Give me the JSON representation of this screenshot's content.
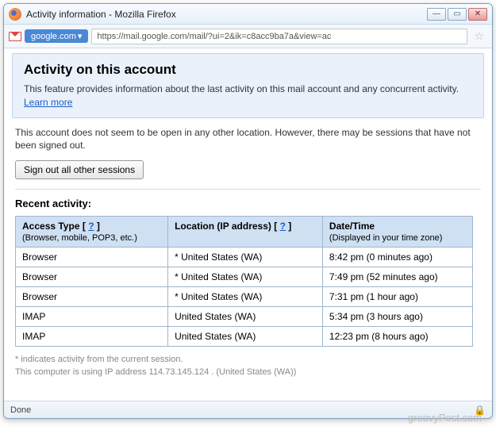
{
  "window": {
    "title": "Activity information - Mozilla Firefox",
    "min": "—",
    "max": "▭",
    "close": "✕"
  },
  "address": {
    "site_label": "google.com",
    "dropdown_glyph": "▾",
    "url": "https://mail.google.com/mail/?ui=2&ik=c8acc9ba7a&view=ac"
  },
  "header": {
    "title": "Activity on this account",
    "description": "This feature provides information about the last activity on this mail account and any concurrent activity.",
    "learn_more": "Learn more"
  },
  "session_info": {
    "message": "This account does not seem to be open in any other location. However, there may be sessions that have not been signed out.",
    "signout_button": "Sign out all other sessions"
  },
  "recent": {
    "title": "Recent activity:",
    "columns": {
      "access": "Access Type",
      "access_sub": "(Browser, mobile, POP3, etc.)",
      "location": "Location (IP address)",
      "datetime": "Date/Time",
      "datetime_sub": "(Displayed in your time zone)",
      "help": "?",
      "bracket_open": "[ ",
      "bracket_close": " ]"
    },
    "rows": [
      {
        "access": "Browser",
        "location": "* United States (WA)",
        "datetime": "8:42 pm (0 minutes ago)"
      },
      {
        "access": "Browser",
        "location": "* United States (WA)",
        "datetime": "7:49 pm (52 minutes ago)"
      },
      {
        "access": "Browser",
        "location": "* United States (WA)",
        "datetime": "7:31 pm (1 hour ago)"
      },
      {
        "access": "IMAP",
        "location": "United States (WA)",
        "datetime": "5:34 pm (3 hours ago)"
      },
      {
        "access": "IMAP",
        "location": "United States (WA)",
        "datetime": "12:23 pm (8 hours ago)"
      }
    ]
  },
  "footnotes": {
    "asterisk": "* indicates activity from the current session.",
    "ip_line": "This computer is using IP address 114.73.145.124 . (United States (WA))"
  },
  "status": {
    "left": "Done"
  },
  "watermark": "groovyPost.com"
}
